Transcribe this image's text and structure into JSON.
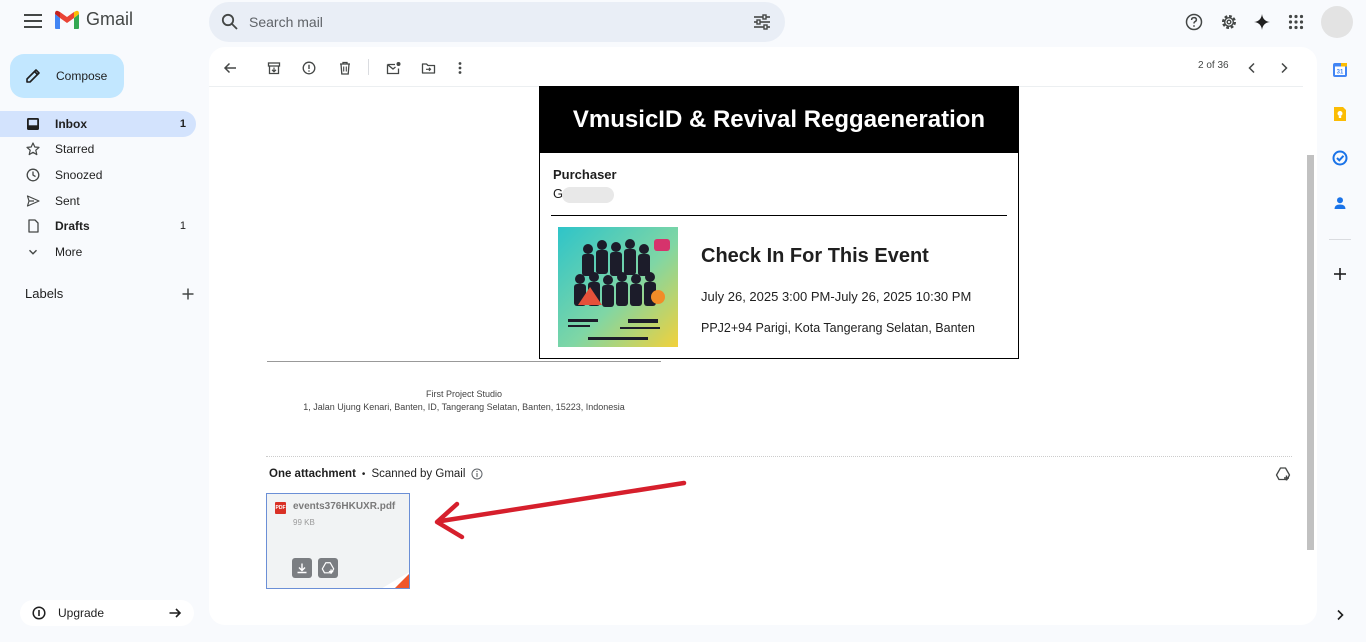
{
  "app": {
    "name": "Gmail"
  },
  "search": {
    "placeholder": "Search mail"
  },
  "compose": {
    "label": "Compose"
  },
  "nav": {
    "items": [
      {
        "label": "Inbox",
        "count": "1"
      },
      {
        "label": "Starred",
        "count": ""
      },
      {
        "label": "Snoozed",
        "count": ""
      },
      {
        "label": "Sent",
        "count": ""
      },
      {
        "label": "Drafts",
        "count": "1"
      },
      {
        "label": "More",
        "count": ""
      }
    ]
  },
  "labels": {
    "title": "Labels"
  },
  "upgrade": {
    "label": "Upgrade"
  },
  "pager": {
    "text": "2 of 36"
  },
  "ticket": {
    "title": "VmusicID & Revival Reggaeneration",
    "purchaser_label": "Purchaser",
    "purchaser_value": "G",
    "event_title": "Check In For This Event",
    "event_date": "July 26, 2025 3:00 PM-July 26, 2025 10:30 PM",
    "event_location": "PPJ2+94 Parigi, Kota Tangerang Selatan, Banten"
  },
  "footer": {
    "studio_name": "First Project Studio",
    "studio_address": "1, Jalan Ujung Kenari, Banten, ID, Tangerang Selatan, Banten, 15223, Indonesia"
  },
  "attachments": {
    "heading": "One attachment",
    "separator": "•",
    "scanned": "Scanned by Gmail",
    "file_type_badge": "PDF",
    "file_name": "events376HKUXR.pdf",
    "file_size": "99 KB"
  },
  "colors": {
    "accent": "#0b57d0",
    "compose_bg": "#c2e7ff",
    "active_nav": "#d3e3fd",
    "annotation_arrow": "#d61f2c"
  }
}
